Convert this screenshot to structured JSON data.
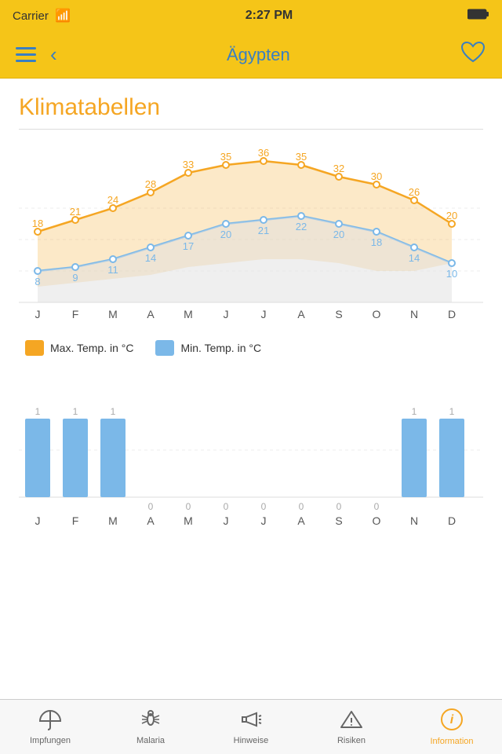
{
  "status": {
    "carrier": "Carrier",
    "time": "2:27 PM",
    "battery": "▮▮▮▮"
  },
  "nav": {
    "title": "Ägypten",
    "back_label": "‹",
    "favorite_label": "♡"
  },
  "section": {
    "title": "Klimatabellen"
  },
  "climate_chart": {
    "months": [
      "J",
      "F",
      "M",
      "A",
      "M",
      "J",
      "J",
      "A",
      "S",
      "O",
      "N",
      "D"
    ],
    "max_temps": [
      18,
      21,
      24,
      28,
      33,
      35,
      36,
      35,
      32,
      30,
      26,
      20
    ],
    "min_temps": [
      8,
      9,
      11,
      14,
      17,
      20,
      21,
      22,
      20,
      18,
      14,
      10
    ],
    "legend_max": "Max. Temp. in °C",
    "legend_min": "Min. Temp. in °C",
    "color_max": "#F5A623",
    "color_min": "#7BB8E8"
  },
  "bar_chart": {
    "months": [
      "J",
      "F",
      "M",
      "A",
      "M",
      "J",
      "J",
      "A",
      "S",
      "O",
      "N",
      "D"
    ],
    "values": [
      1,
      1,
      1,
      0,
      0,
      0,
      0,
      0,
      0,
      0,
      1,
      1
    ],
    "color": "#7BB8E8"
  },
  "tabs": [
    {
      "id": "impfungen",
      "label": "Impfungen",
      "icon": "umbrella",
      "active": false
    },
    {
      "id": "malaria",
      "label": "Malaria",
      "icon": "mosquito",
      "active": false
    },
    {
      "id": "hinweise",
      "label": "Hinweise",
      "icon": "megaphone",
      "active": false
    },
    {
      "id": "risiken",
      "label": "Risiken",
      "icon": "warning",
      "active": false
    },
    {
      "id": "information",
      "label": "Information",
      "icon": "info",
      "active": true
    }
  ]
}
